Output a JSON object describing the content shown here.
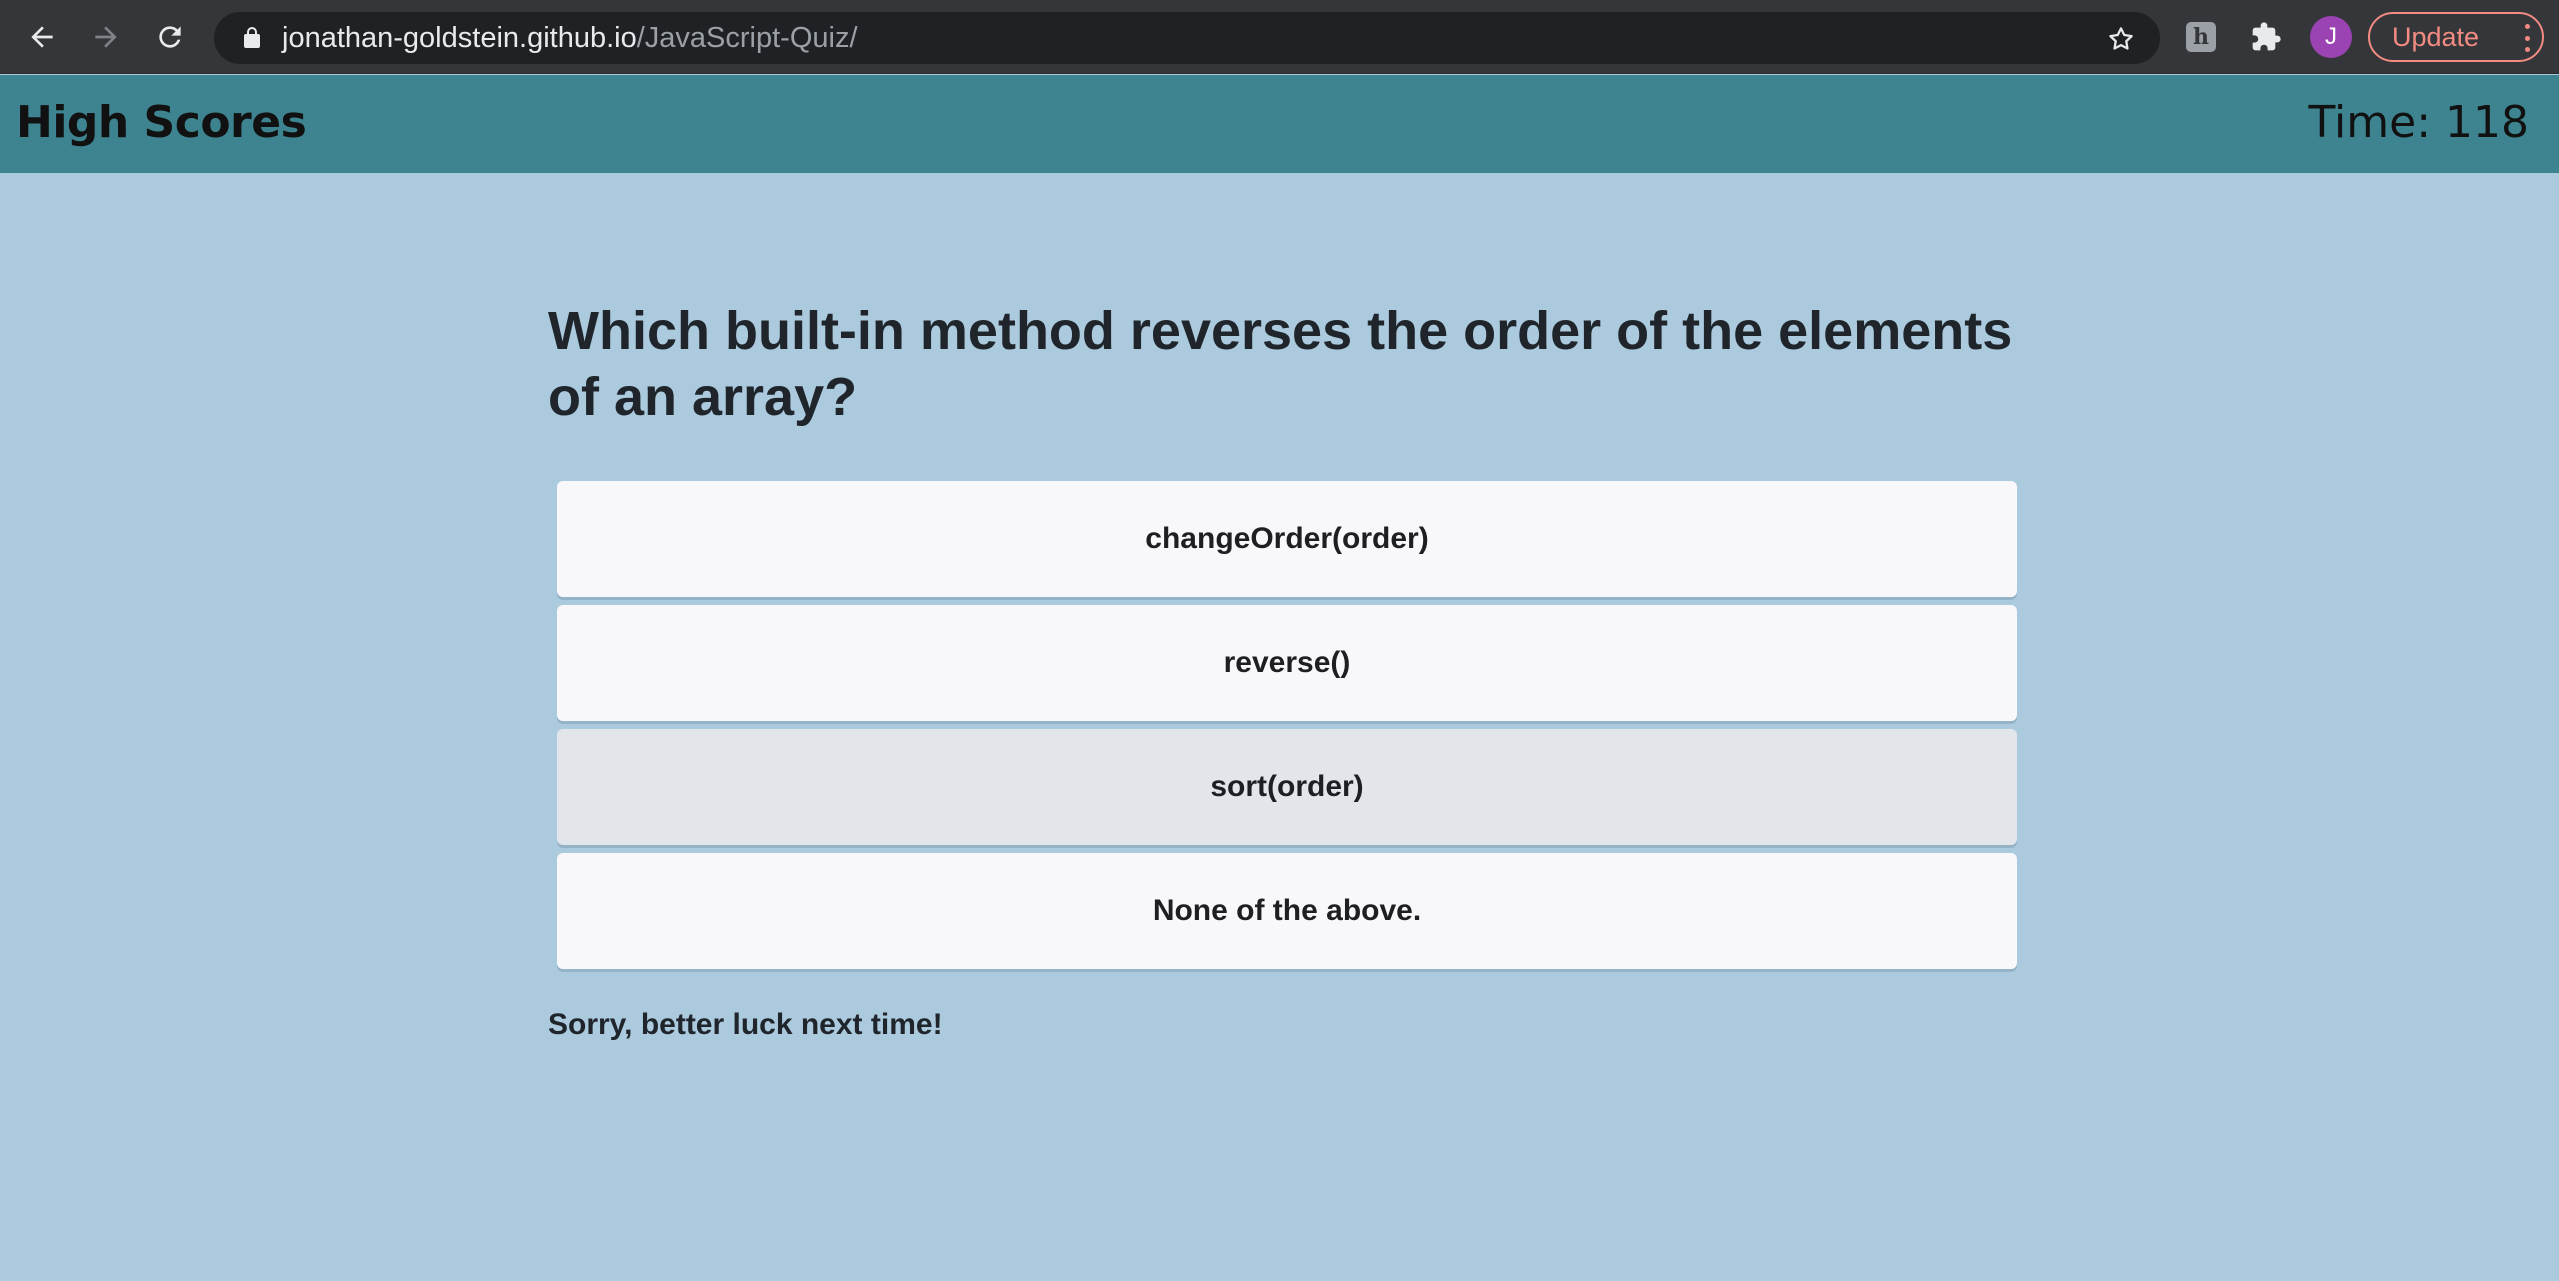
{
  "browser": {
    "url_host": "jonathan-goldstein.github.io",
    "url_path": "/JavaScript-Quiz/",
    "extension_badge": "h",
    "profile_initial": "J",
    "update_label": "Update",
    "icons": [
      "back-arrow-icon",
      "forward-arrow-icon",
      "reload-icon",
      "lock-icon",
      "star-icon",
      "extension-icon",
      "puzzle-icon",
      "kebab-menu-icon"
    ],
    "colors": {
      "chrome_bg": "#35363a",
      "omnibox_bg": "#202124",
      "update_accent": "#f28b82",
      "avatar_bg": "#9c43b3"
    }
  },
  "header": {
    "high_scores_label": "High Scores",
    "timer_text": "Time: 118",
    "colors": {
      "bg": "#3e8490"
    }
  },
  "quiz": {
    "question": "Which built-in method reverses the order of the elements of an array?",
    "answers": [
      {
        "label": "changeOrder(order)",
        "highlighted": false
      },
      {
        "label": "reverse()",
        "highlighted": false
      },
      {
        "label": "sort(order)",
        "highlighted": true
      },
      {
        "label": "None of the above.",
        "highlighted": false
      }
    ],
    "feedback": "Sorry, better luck next time!",
    "colors": {
      "page_bg": "#abcade",
      "answer_bg": "#f8f8fa",
      "answer_hover_bg": "#e2e6ea"
    }
  }
}
